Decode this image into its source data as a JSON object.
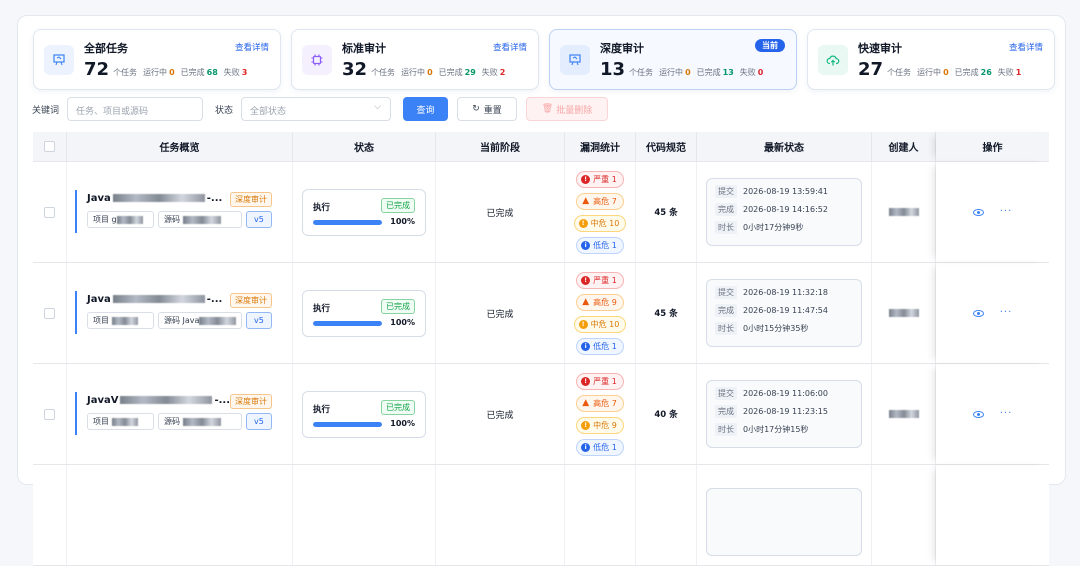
{
  "cards": [
    {
      "title": "全部任务",
      "link": "查看详情",
      "count": "72",
      "unit": "个任务",
      "running_label": "运行中",
      "running": "0",
      "done_label": "已完成",
      "done": "68",
      "fail_label": "失败",
      "fail": "3",
      "icon": "whiteboard-icon",
      "color": "#3b82f6",
      "active": false
    },
    {
      "title": "标准审计",
      "link": "查看详情",
      "count": "32",
      "unit": "个任务",
      "running_label": "运行中",
      "running": "0",
      "done_label": "已完成",
      "done": "29",
      "fail_label": "失败",
      "fail": "2",
      "icon": "chip-icon",
      "color": "#8b5cf6",
      "active": false
    },
    {
      "title": "深度审计",
      "badge": "当前",
      "count": "13",
      "unit": "个任务",
      "running_label": "运行中",
      "running": "0",
      "done_label": "已完成",
      "done": "13",
      "fail_label": "失败",
      "fail": "0",
      "icon": "whiteboard-icon",
      "color": "#3b82f6",
      "active": true
    },
    {
      "title": "快速审计",
      "link": "查看详情",
      "count": "27",
      "unit": "个任务",
      "running_label": "运行中",
      "running": "0",
      "done_label": "已完成",
      "done": "26",
      "fail_label": "失败",
      "fail": "1",
      "icon": "cloud-upload-icon",
      "color": "#10b981",
      "active": false
    }
  ],
  "filters": {
    "keyword_label": "关键词",
    "keyword_placeholder": "任务、项目或源码",
    "status_label": "状态",
    "status_placeholder": "全部状态",
    "query": "查询",
    "reset": "重置",
    "batch_delete": "批量删除"
  },
  "columns": [
    "任务概览",
    "状态",
    "当前阶段",
    "漏洞统计",
    "代码规范",
    "最新状态",
    "创建人",
    "操作"
  ],
  "rows": [
    {
      "name_prefix": "Java",
      "name_suffix": "-...",
      "tag": "深度审计",
      "project_label": "项目",
      "project_prefix": "g",
      "source_label": "源码",
      "source_prefix": "",
      "version": "v5",
      "state_label": "执行",
      "state_badge": "已完成",
      "progress": 100,
      "progress_text": "100%",
      "stage": "已完成",
      "vulns": [
        {
          "k": "sev",
          "icon": "!",
          "t": "严重 1"
        },
        {
          "k": "high",
          "icon": "▲",
          "t": "高危 7"
        },
        {
          "k": "mid",
          "icon": "!",
          "t": "中危 10"
        },
        {
          "k": "low",
          "icon": "i",
          "t": "低危 1"
        }
      ],
      "code_spec": "45 条",
      "submit_k": "提交",
      "submit": "2026-08-19 13:59:41",
      "done_k": "完成",
      "done": "2026-08-19 14:16:52",
      "dur_k": "时长",
      "dur": "0小时17分钟9秒"
    },
    {
      "name_prefix": "Java",
      "name_suffix": "-...",
      "tag": "深度审计",
      "project_label": "项目",
      "project_prefix": "",
      "source_label": "源码",
      "source_prefix": "Java",
      "version": "v5",
      "state_label": "执行",
      "state_badge": "已完成",
      "progress": 100,
      "progress_text": "100%",
      "stage": "已完成",
      "vulns": [
        {
          "k": "sev",
          "icon": "!",
          "t": "严重 1"
        },
        {
          "k": "high",
          "icon": "▲",
          "t": "高危 9"
        },
        {
          "k": "mid",
          "icon": "!",
          "t": "中危 10"
        },
        {
          "k": "low",
          "icon": "i",
          "t": "低危 1"
        }
      ],
      "code_spec": "45 条",
      "submit_k": "提交",
      "submit": "2026-08-19 11:32:18",
      "done_k": "完成",
      "done": "2026-08-19 11:47:54",
      "dur_k": "时长",
      "dur": "0小时15分钟35秒"
    },
    {
      "name_prefix": "JavaV",
      "name_suffix": "-...",
      "tag": "深度审计",
      "project_label": "项目",
      "project_prefix": "",
      "source_label": "源码",
      "source_prefix": "",
      "version": "v5",
      "state_label": "执行",
      "state_badge": "已完成",
      "progress": 100,
      "progress_text": "100%",
      "stage": "已完成",
      "vulns": [
        {
          "k": "sev",
          "icon": "!",
          "t": "严重 1"
        },
        {
          "k": "high",
          "icon": "▲",
          "t": "高危 7"
        },
        {
          "k": "mid",
          "icon": "!",
          "t": "中危 9"
        },
        {
          "k": "low",
          "icon": "i",
          "t": "低危 1"
        }
      ],
      "code_spec": "40 条",
      "submit_k": "提交",
      "submit": "2026-08-19 11:06:00",
      "done_k": "完成",
      "done": "2026-08-19 11:23:15",
      "dur_k": "时长",
      "dur": "0小时17分钟15秒"
    }
  ]
}
